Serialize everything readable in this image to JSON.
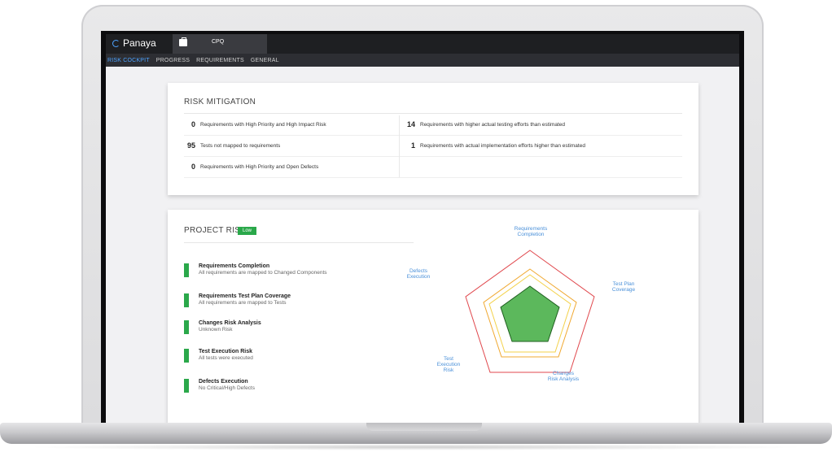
{
  "app": {
    "brand": "Panaya",
    "project_tab": "CPQ",
    "nav": [
      {
        "label": "RISK COCKPIT",
        "active": true
      },
      {
        "label": "PROGRESS",
        "active": false
      },
      {
        "label": "REQUIREMENTS",
        "active": false
      },
      {
        "label": "GENERAL",
        "active": false
      }
    ]
  },
  "risk_mitigation": {
    "title": "RISK MITIGATION",
    "left": [
      {
        "count": "0",
        "label": "Requirements with High Priority and High Impact Risk"
      },
      {
        "count": "95",
        "label": "Tests not mapped to requirements"
      },
      {
        "count": "0",
        "label": "Requirements with High Priority and Open Defects"
      }
    ],
    "right": [
      {
        "count": "14",
        "label": "Requirements with higher actual testing efforts than estimated"
      },
      {
        "count": "1",
        "label": "Requirements with actual implementation efforts higher than estimated"
      }
    ]
  },
  "project_risk": {
    "title": "PROJECT RISK",
    "level": "Low",
    "items": [
      {
        "title": "Requirements Completion",
        "desc": "All requirements are mapped to Changed Components"
      },
      {
        "title": "Requirements Test Plan Coverage",
        "desc": "All requirements are mapped to Tests"
      },
      {
        "title": "Changes Risk Analysis",
        "desc": "Unknown Risk"
      },
      {
        "title": "Test Execution Risk",
        "desc": "All tests were executed"
      },
      {
        "title": "Defects Execution",
        "desc": "No Critical/High Defects"
      }
    ],
    "radar_labels": {
      "top": "Requirements Completion",
      "right": "Test Plan Coverage",
      "bottom_right": "Changes Risk Analysis",
      "bottom_left": "Test Execution Risk",
      "left": "Defects Execution"
    },
    "colors": {
      "fill": "#5cb85c",
      "outer": "#e0474c",
      "middle": "#f0a830",
      "inner": "#f3d14a"
    }
  }
}
